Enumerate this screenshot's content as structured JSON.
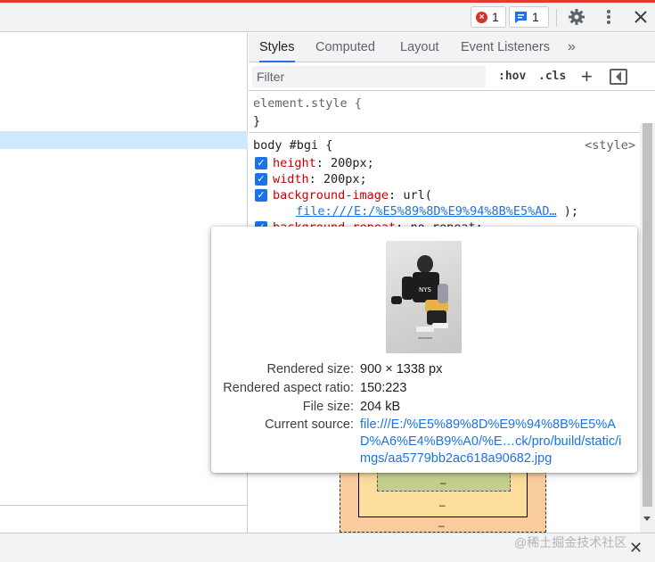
{
  "toolbar": {
    "error_count": "1",
    "issue_count": "1",
    "icons": [
      "error-icon",
      "message-icon",
      "gear-icon",
      "kebab-menu-icon",
      "close-icon"
    ]
  },
  "tabs": {
    "styles": "Styles",
    "computed": "Computed",
    "layout": "Layout",
    "event_listeners": "Event Listeners",
    "more": "»",
    "active": "Styles"
  },
  "filter": {
    "placeholder": "Filter",
    "hov": ":hov",
    "cls": ".cls",
    "plus": "+"
  },
  "element_style": {
    "selector": "element.style {",
    "close": "}"
  },
  "body_rule": {
    "selector": "body #bgi {",
    "source": "<style>",
    "declarations": [
      {
        "prop": "height",
        "value": "200px;"
      },
      {
        "prop": "width",
        "value": "200px;"
      },
      {
        "prop": "background-image",
        "value": "url("
      },
      {
        "prop": "background-repeat",
        "value": "no-repeat;"
      }
    ],
    "url_link": "file:///E:/%E5%89%8D%E9%94%8B%E5%AD…",
    "url_close": ");"
  },
  "box_model": {
    "dash": "–"
  },
  "popover": {
    "rendered_size_label": "Rendered size:",
    "rendered_size_value": "900 × 1338 px",
    "aspect_label": "Rendered aspect ratio:",
    "aspect_value": "150:223",
    "filesize_label": "File size:",
    "filesize_value": "204 kB",
    "source_label": "Current source:",
    "source_line1": "file:///E:/%E5%89%8D%E9%94%8B%E5%A",
    "source_line2": "D%A6%E4%B9%A0/%E…ck/pro/build/static/i",
    "source_line3": "mgs/aa5779bb2ac618a90682.jpg"
  },
  "drawer": {
    "watermark": "@稀土掘金技术社区",
    "close": "✕"
  },
  "colors": {
    "accent": "#1a73e8",
    "property": "#c80000",
    "error": "#d93025",
    "selection": "#cfe8fc",
    "margin_box": "#f9cc9d",
    "border_box": "#fddd9b",
    "padding_box": "#c3d08b"
  }
}
